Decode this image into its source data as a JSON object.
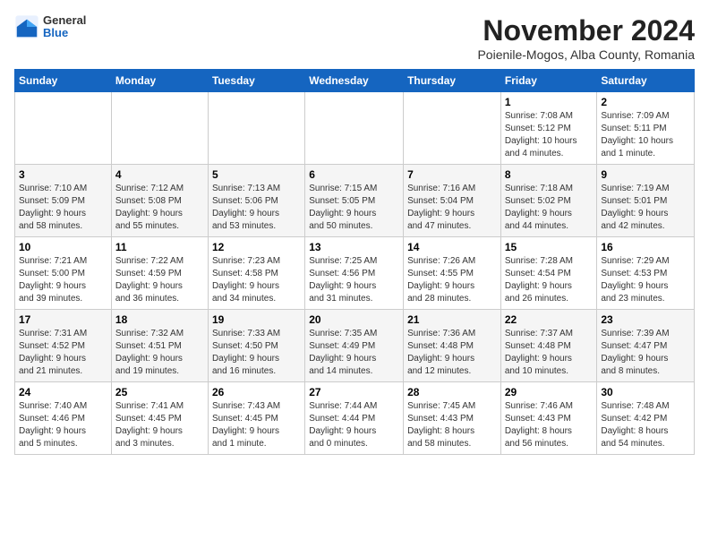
{
  "logo": {
    "general": "General",
    "blue": "Blue"
  },
  "title": "November 2024",
  "subtitle": "Poienile-Mogos, Alba County, Romania",
  "weekdays": [
    "Sunday",
    "Monday",
    "Tuesday",
    "Wednesday",
    "Thursday",
    "Friday",
    "Saturday"
  ],
  "weeks": [
    [
      {
        "day": "",
        "detail": ""
      },
      {
        "day": "",
        "detail": ""
      },
      {
        "day": "",
        "detail": ""
      },
      {
        "day": "",
        "detail": ""
      },
      {
        "day": "",
        "detail": ""
      },
      {
        "day": "1",
        "detail": "Sunrise: 7:08 AM\nSunset: 5:12 PM\nDaylight: 10 hours\nand 4 minutes."
      },
      {
        "day": "2",
        "detail": "Sunrise: 7:09 AM\nSunset: 5:11 PM\nDaylight: 10 hours\nand 1 minute."
      }
    ],
    [
      {
        "day": "3",
        "detail": "Sunrise: 7:10 AM\nSunset: 5:09 PM\nDaylight: 9 hours\nand 58 minutes."
      },
      {
        "day": "4",
        "detail": "Sunrise: 7:12 AM\nSunset: 5:08 PM\nDaylight: 9 hours\nand 55 minutes."
      },
      {
        "day": "5",
        "detail": "Sunrise: 7:13 AM\nSunset: 5:06 PM\nDaylight: 9 hours\nand 53 minutes."
      },
      {
        "day": "6",
        "detail": "Sunrise: 7:15 AM\nSunset: 5:05 PM\nDaylight: 9 hours\nand 50 minutes."
      },
      {
        "day": "7",
        "detail": "Sunrise: 7:16 AM\nSunset: 5:04 PM\nDaylight: 9 hours\nand 47 minutes."
      },
      {
        "day": "8",
        "detail": "Sunrise: 7:18 AM\nSunset: 5:02 PM\nDaylight: 9 hours\nand 44 minutes."
      },
      {
        "day": "9",
        "detail": "Sunrise: 7:19 AM\nSunset: 5:01 PM\nDaylight: 9 hours\nand 42 minutes."
      }
    ],
    [
      {
        "day": "10",
        "detail": "Sunrise: 7:21 AM\nSunset: 5:00 PM\nDaylight: 9 hours\nand 39 minutes."
      },
      {
        "day": "11",
        "detail": "Sunrise: 7:22 AM\nSunset: 4:59 PM\nDaylight: 9 hours\nand 36 minutes."
      },
      {
        "day": "12",
        "detail": "Sunrise: 7:23 AM\nSunset: 4:58 PM\nDaylight: 9 hours\nand 34 minutes."
      },
      {
        "day": "13",
        "detail": "Sunrise: 7:25 AM\nSunset: 4:56 PM\nDaylight: 9 hours\nand 31 minutes."
      },
      {
        "day": "14",
        "detail": "Sunrise: 7:26 AM\nSunset: 4:55 PM\nDaylight: 9 hours\nand 28 minutes."
      },
      {
        "day": "15",
        "detail": "Sunrise: 7:28 AM\nSunset: 4:54 PM\nDaylight: 9 hours\nand 26 minutes."
      },
      {
        "day": "16",
        "detail": "Sunrise: 7:29 AM\nSunset: 4:53 PM\nDaylight: 9 hours\nand 23 minutes."
      }
    ],
    [
      {
        "day": "17",
        "detail": "Sunrise: 7:31 AM\nSunset: 4:52 PM\nDaylight: 9 hours\nand 21 minutes."
      },
      {
        "day": "18",
        "detail": "Sunrise: 7:32 AM\nSunset: 4:51 PM\nDaylight: 9 hours\nand 19 minutes."
      },
      {
        "day": "19",
        "detail": "Sunrise: 7:33 AM\nSunset: 4:50 PM\nDaylight: 9 hours\nand 16 minutes."
      },
      {
        "day": "20",
        "detail": "Sunrise: 7:35 AM\nSunset: 4:49 PM\nDaylight: 9 hours\nand 14 minutes."
      },
      {
        "day": "21",
        "detail": "Sunrise: 7:36 AM\nSunset: 4:48 PM\nDaylight: 9 hours\nand 12 minutes."
      },
      {
        "day": "22",
        "detail": "Sunrise: 7:37 AM\nSunset: 4:48 PM\nDaylight: 9 hours\nand 10 minutes."
      },
      {
        "day": "23",
        "detail": "Sunrise: 7:39 AM\nSunset: 4:47 PM\nDaylight: 9 hours\nand 8 minutes."
      }
    ],
    [
      {
        "day": "24",
        "detail": "Sunrise: 7:40 AM\nSunset: 4:46 PM\nDaylight: 9 hours\nand 5 minutes."
      },
      {
        "day": "25",
        "detail": "Sunrise: 7:41 AM\nSunset: 4:45 PM\nDaylight: 9 hours\nand 3 minutes."
      },
      {
        "day": "26",
        "detail": "Sunrise: 7:43 AM\nSunset: 4:45 PM\nDaylight: 9 hours\nand 1 minute."
      },
      {
        "day": "27",
        "detail": "Sunrise: 7:44 AM\nSunset: 4:44 PM\nDaylight: 9 hours\nand 0 minutes."
      },
      {
        "day": "28",
        "detail": "Sunrise: 7:45 AM\nSunset: 4:43 PM\nDaylight: 8 hours\nand 58 minutes."
      },
      {
        "day": "29",
        "detail": "Sunrise: 7:46 AM\nSunset: 4:43 PM\nDaylight: 8 hours\nand 56 minutes."
      },
      {
        "day": "30",
        "detail": "Sunrise: 7:48 AM\nSunset: 4:42 PM\nDaylight: 8 hours\nand 54 minutes."
      }
    ]
  ]
}
